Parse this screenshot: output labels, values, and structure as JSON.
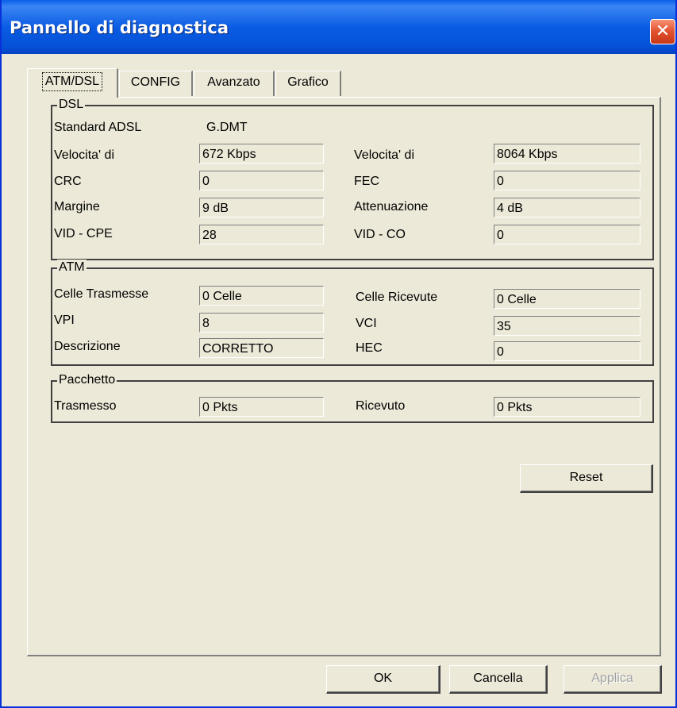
{
  "window": {
    "title": "Pannello di diagnostica",
    "close_glyph": "✕"
  },
  "tabs": [
    {
      "label": "ATM/DSL",
      "active": true
    },
    {
      "label": "CONFIG",
      "active": false
    },
    {
      "label": "Avanzato",
      "active": false
    },
    {
      "label": "Grafico",
      "active": false
    }
  ],
  "dsl": {
    "legend": "DSL",
    "standard_label": "Standard ADSL",
    "standard_value": "G.DMT",
    "rows": [
      {
        "left_label": "Velocita' di",
        "left_value": "672 Kbps",
        "right_label": "Velocita' di",
        "right_value": "8064 Kbps"
      },
      {
        "left_label": "CRC",
        "left_value": "0",
        "right_label": "FEC",
        "right_value": "0"
      },
      {
        "left_label": "Margine",
        "left_value": "9 dB",
        "right_label": "Attenuazione",
        "right_value": "4 dB"
      },
      {
        "left_label": "VID - CPE",
        "left_value": "28",
        "right_label": "VID - CO",
        "right_value": "0"
      }
    ]
  },
  "atm": {
    "legend": "ATM",
    "rows": [
      {
        "left_label": "Celle Trasmesse",
        "left_value": "0 Celle",
        "right_label": "Celle Ricevute",
        "right_value": "0 Celle"
      },
      {
        "left_label": "VPI",
        "left_value": "8",
        "right_label": "VCI",
        "right_value": "35"
      },
      {
        "left_label": "Descrizione",
        "left_value": "CORRETTO",
        "right_label": "HEC",
        "right_value": "0"
      }
    ]
  },
  "packet": {
    "legend": "Pacchetto",
    "left_label": "Trasmesso",
    "left_value": "0 Pkts",
    "right_label": "Ricevuto",
    "right_value": "0 Pkts"
  },
  "buttons": {
    "reset": "Reset",
    "ok": "OK",
    "cancel": "Cancella",
    "apply": "Applica"
  },
  "colors": {
    "titlebar": "#0a5ce3",
    "close": "#e2502c",
    "face": "#ece9d8"
  }
}
